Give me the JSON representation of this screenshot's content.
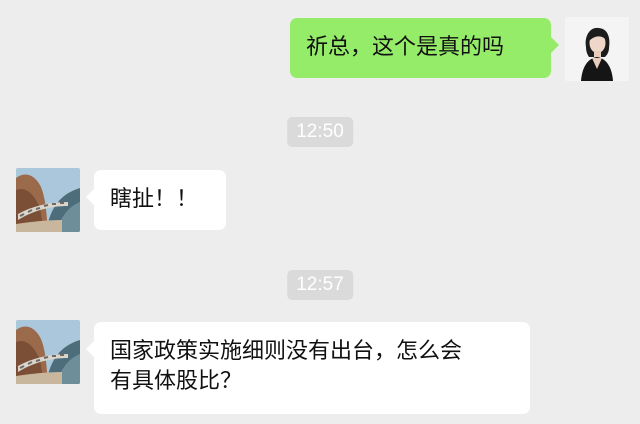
{
  "messages": [
    {
      "sender": "self",
      "text": "祈总，这个是真的吗"
    },
    {
      "type": "time",
      "text": "12:50"
    },
    {
      "sender": "other",
      "text": "瞎扯！！"
    },
    {
      "type": "time",
      "text": "12:57"
    },
    {
      "sender": "other",
      "text": "国家政策实施细则没有出台，怎么会\n有具体股比？"
    }
  ],
  "colors": {
    "background": "#ededed",
    "bubble_self": "#95ec69",
    "bubble_other": "#ffffff",
    "timestamp_bg": "#dadada"
  },
  "icons": {
    "self_avatar": "woman-portrait-avatar",
    "other_avatar": "mountain-railway-avatar"
  }
}
